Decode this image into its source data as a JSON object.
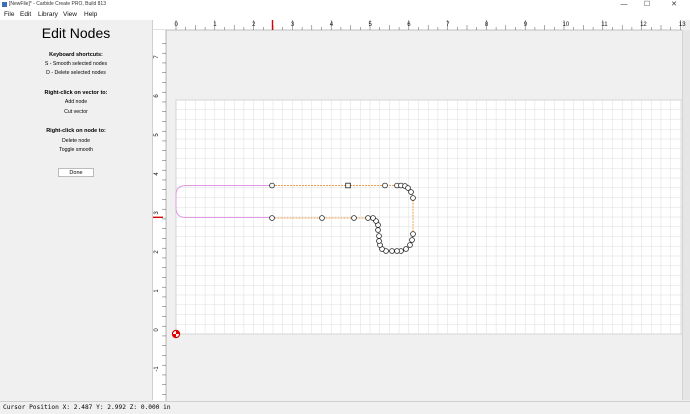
{
  "window": {
    "title": "[NewFile]* - Carbide Create PRO, Build 813",
    "minimize": "—",
    "maximize": "☐",
    "close": "✕"
  },
  "menu": [
    "File",
    "Edit",
    "Library",
    "View",
    "Help"
  ],
  "panel": {
    "title": "Edit Nodes",
    "shortcuts_heading": "Keyboard shortcuts:",
    "shortcut_smooth": "S - Smooth selected nodes",
    "shortcut_delete": "D - Delete selected nodes",
    "vector_heading": "Right-click on vector to:",
    "vector_add": "Add node",
    "vector_cut": "Cut vector",
    "node_heading": "Right-click on node to:",
    "node_delete": "Delete node",
    "node_toggle": "Toggle smooth",
    "done_label": "Done"
  },
  "ruler": {
    "x_labels": [
      "0",
      "1",
      "2",
      "3",
      "4",
      "5",
      "6",
      "7",
      "8",
      "9",
      "10",
      "11",
      "12",
      "13"
    ],
    "y_labels": [
      "7",
      "6",
      "5",
      "4",
      "3",
      "2",
      "1",
      "0",
      "-1"
    ],
    "cursor_x": 2.487,
    "cursor_y": 2.992
  },
  "colors": {
    "selected_path": "#f0a050",
    "other_path": "#e29ae6",
    "grid": "#dcdcdc",
    "cursor_marker": "#dd0000"
  },
  "status": "Cursor Position X: 2.487 Y: 2.992 Z: 0.000 in"
}
